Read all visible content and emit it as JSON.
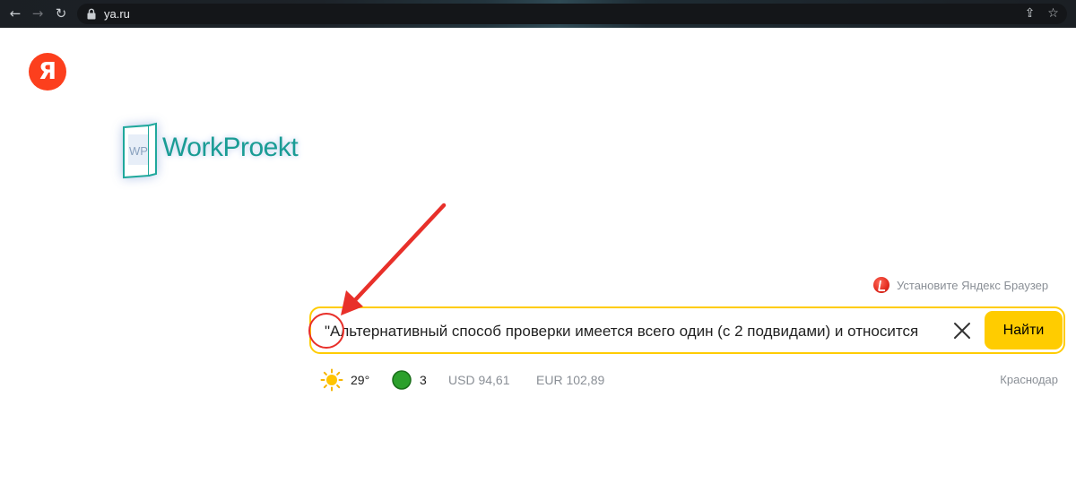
{
  "browser": {
    "url": "ya.ru",
    "back_icon": "arrow-left-icon",
    "forward_icon": "arrow-right-icon",
    "reload_icon": "reload-icon",
    "lock_icon": "lock-icon",
    "share_icon": "share-icon",
    "bookmark_icon": "star-icon"
  },
  "logo": {
    "letter": "Я",
    "color": "#fc3f1d"
  },
  "watermark": {
    "text": "WorkProekt",
    "mark": "WP",
    "color": "#1a9c95"
  },
  "install_hint": {
    "text": "Установите Яндекс Браузер",
    "icon": "yandex-browser-icon"
  },
  "search": {
    "query": "\"Альтернативный способ проверки имеется всего один (с 2 подвидами) и относится",
    "clear_icon": "close-icon",
    "button_label": "Найти",
    "accent": "#ffcc00"
  },
  "informers": {
    "weather": "29°",
    "weather_icon": "sun-icon",
    "traffic": "3",
    "traffic_icon": "traffic-light-icon",
    "usd": "USD 94,61",
    "eur": "EUR 102,89",
    "city": "Краснодар"
  },
  "annotation": {
    "color": "#e8302a"
  }
}
